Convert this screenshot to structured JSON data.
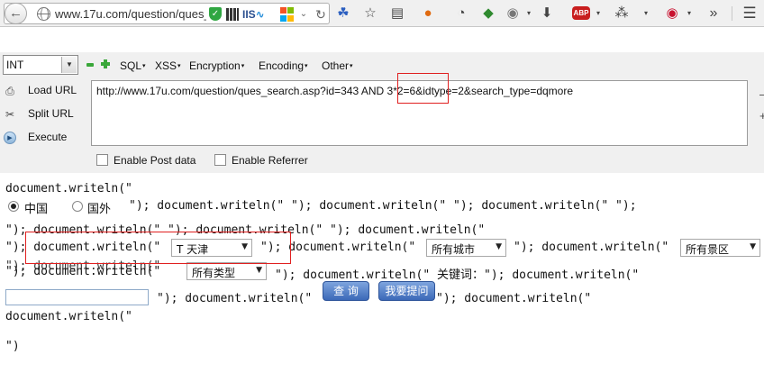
{
  "browser": {
    "url": "www.17u.com/question/ques_search.asp?id=343 AND 3*2=6&idtype=2&search_type=dqmore",
    "iis_label": "IIS",
    "adblock_label": "ABP",
    "icons": [
      "back-arrow-icon",
      "globe-icon",
      "shield-icon",
      "qr-icon",
      "windows-icon",
      "reload-icon",
      "blue-feather-icon",
      "star-icon",
      "bookmarks-icon",
      "firefox-icon",
      "palette-icon",
      "green-shield-icon",
      "grey-circle-icon",
      "download-icon",
      "adblock-icon",
      "bug-icon",
      "red-swirl-icon",
      "more-icon",
      "hamburger-menu-icon"
    ]
  },
  "hackbar": {
    "type_select": "INT",
    "menus": [
      {
        "label": "SQL"
      },
      {
        "label": "XSS"
      },
      {
        "label": "Encryption"
      },
      {
        "label": "Encoding"
      },
      {
        "label": "Other"
      }
    ],
    "actions": [
      {
        "label": "Load URL"
      },
      {
        "label": "Split URL"
      },
      {
        "label": "Execute"
      }
    ],
    "url_value": "http://www.17u.com/question/ques_search.asp?id=343 AND 3*2=6&idtype=2&search_type=dqmore",
    "options": [
      {
        "label": "Enable Post data",
        "checked": false
      },
      {
        "label": "Enable Referrer",
        "checked": false
      }
    ]
  },
  "page": {
    "line1": "document.writeln(\"",
    "radio_china": "中国",
    "radio_foreign": "国外",
    "line2_rest": "\"); document.writeln(\" \"); document.writeln(\" \"); document.writeln(\" \");",
    "line3": "\"); document.writeln(\" \"); document.writeln(\" \"); document.writeln(\"",
    "line4_a": "\"); document.writeln(\"",
    "city_select": "T 天津",
    "line4_b": "\"); document.writeln(\"",
    "all_city_select": "所有城市",
    "line4_c": "\"); document.writeln(\"",
    "scenic_select": "所有景区",
    "line5_overlap": "\"); document.writeln(\"",
    "line5_a": "\"); document.writeln(\"",
    "type_select": "所有类型",
    "line5_b": "\"); document.writeln(\" 关键词：\"); document.writeln(\"",
    "line6_a": "\"); document.writeln(\"",
    "query_button": "查 询",
    "ask_button": "我要提问",
    "line6_b": "\"); document.writeln(\"",
    "line7": "document.writeln(\"",
    "line8": "\")"
  }
}
